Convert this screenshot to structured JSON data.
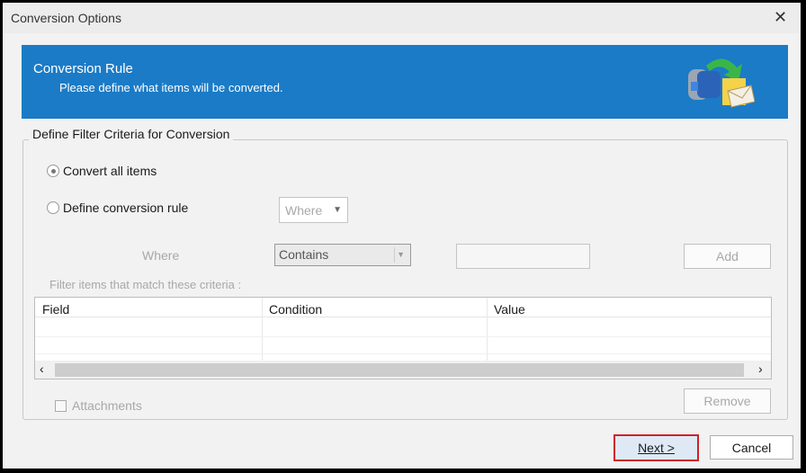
{
  "window": {
    "title": "Conversion Options",
    "close_icon": "close-icon"
  },
  "banner": {
    "title": "Conversion Rule",
    "subtitle": "Please define what items will be converted.",
    "icon": "mailbox-convert-icon",
    "color": "#1b7bc6"
  },
  "group": {
    "legend": "Define Filter Criteria for Conversion",
    "options": [
      {
        "label": "Convert all items",
        "selected": true
      },
      {
        "label": "Define conversion rule",
        "selected": false
      }
    ],
    "where_dropdown": "Where",
    "where_label": "Where",
    "condition_dropdown": "Contains",
    "value_input": "",
    "add_label": "Add",
    "filter_label": "Filter items that match these criteria :",
    "table": {
      "columns": [
        "Field",
        "Condition",
        "Value"
      ],
      "rows": []
    },
    "attachments_label": "Attachments",
    "attachments_checked": false,
    "remove_label": "Remove"
  },
  "footer": {
    "next_label": "Next >",
    "cancel_label": "Cancel",
    "highlight_color": "#d0202a"
  }
}
